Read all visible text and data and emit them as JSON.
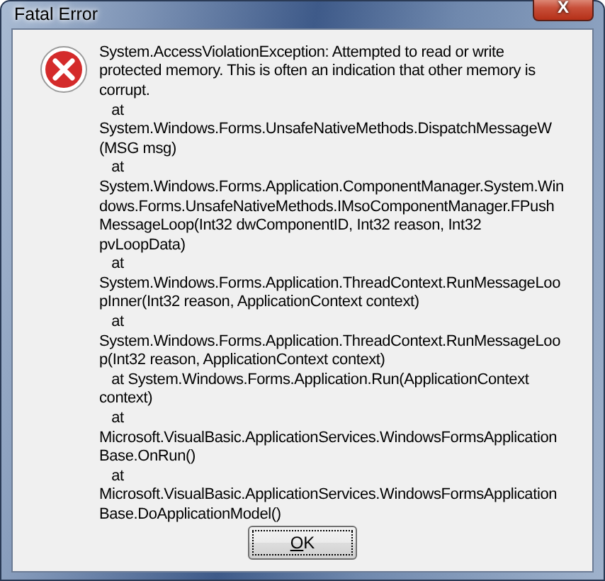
{
  "window": {
    "title": "Fatal Error",
    "close_button": "X"
  },
  "message_lines": [
    "System.AccessViolationException: Attempted to read or write",
    "protected memory. This is often an indication that other memory is",
    "corrupt.",
    "   at",
    "System.Windows.Forms.UnsafeNativeMethods.DispatchMessageW",
    "(MSG msg)",
    "   at",
    "System.Windows.Forms.Application.ComponentManager.System.Win",
    "dows.Forms.UnsafeNativeMethods.IMsoComponentManager.FPush",
    "MessageLoop(Int32 dwComponentID, Int32 reason, Int32",
    "pvLoopData)",
    "   at",
    "System.Windows.Forms.Application.ThreadContext.RunMessageLoo",
    "pInner(Int32 reason, ApplicationContext context)",
    "   at",
    "System.Windows.Forms.Application.ThreadContext.RunMessageLoo",
    "p(Int32 reason, ApplicationContext context)",
    "   at System.Windows.Forms.Application.Run(ApplicationContext",
    "context)",
    "   at",
    "Microsoft.VisualBasic.ApplicationServices.WindowsFormsApplication",
    "Base.OnRun()",
    "   at",
    "Microsoft.VisualBasic.ApplicationServices.WindowsFormsApplication",
    "Base.DoApplicationModel()"
  ],
  "buttons": [
    {
      "label": "OK",
      "focused": true
    }
  ]
}
